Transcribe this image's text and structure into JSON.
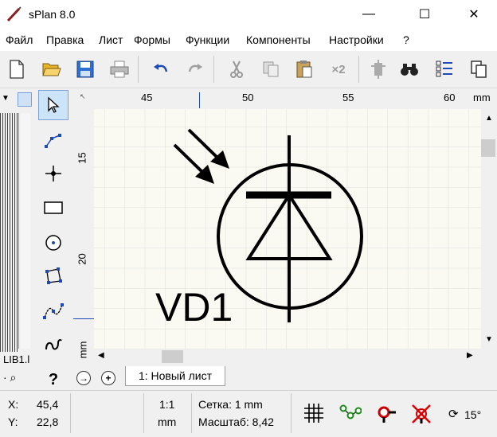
{
  "window": {
    "title": "sPlan 8.0",
    "minimize_glyph": "—",
    "maximize_glyph": "☐",
    "close_glyph": "✕"
  },
  "menu": [
    "Файл",
    "Правка",
    "Лист",
    "Формы",
    "Функции",
    "Компоненты",
    "Настройки",
    "?"
  ],
  "toolbar": {
    "icons": [
      "new-file-icon",
      "open-folder-icon",
      "save-icon",
      "print-icon",
      "undo-icon",
      "redo-icon",
      "cut-icon",
      "copy-icon",
      "paste-icon",
      "duplicate-x2-icon",
      "component-icon",
      "binoculars-icon",
      "checklist-icon",
      "pages-icon"
    ],
    "x2_label": "×2"
  },
  "library": {
    "label": "LIB1.l",
    "search_glyph": "🔍"
  },
  "tools": [
    "pointer-tool",
    "polyline-tool",
    "junction-tool",
    "rectangle-tool",
    "circle-tool",
    "polygon-tool",
    "bezier-tool",
    "freehand-tool",
    "help-tool"
  ],
  "help_glyph": "?",
  "ruler": {
    "h_ticks": [
      "45",
      "50",
      "55",
      "60"
    ],
    "h_unit": "mm",
    "v_ticks": [
      "15",
      "20"
    ],
    "v_unit": "mm"
  },
  "schematic": {
    "component_label": "VD1"
  },
  "sheets": {
    "nav_next": "→",
    "add": "+",
    "tabs": [
      "1: Новый лист"
    ]
  },
  "status": {
    "x_label": "X:",
    "x_value": "45,4",
    "y_label": "Y:",
    "y_value": "22,8",
    "scale_ratio": "1:1",
    "unit": "mm",
    "grid_text": "Сетка: 1 mm",
    "zoom_text": "Масштаб: 8,42",
    "rotation_text": "15°"
  },
  "colors": {
    "canvas_bg": "#fafaf2",
    "grid_line": "#dedede",
    "accent_blue": "#1c4bb3",
    "save_blue": "#2f6fd1",
    "folder_yellow": "#e9b52a",
    "tool_selected": "#cce4f7"
  }
}
